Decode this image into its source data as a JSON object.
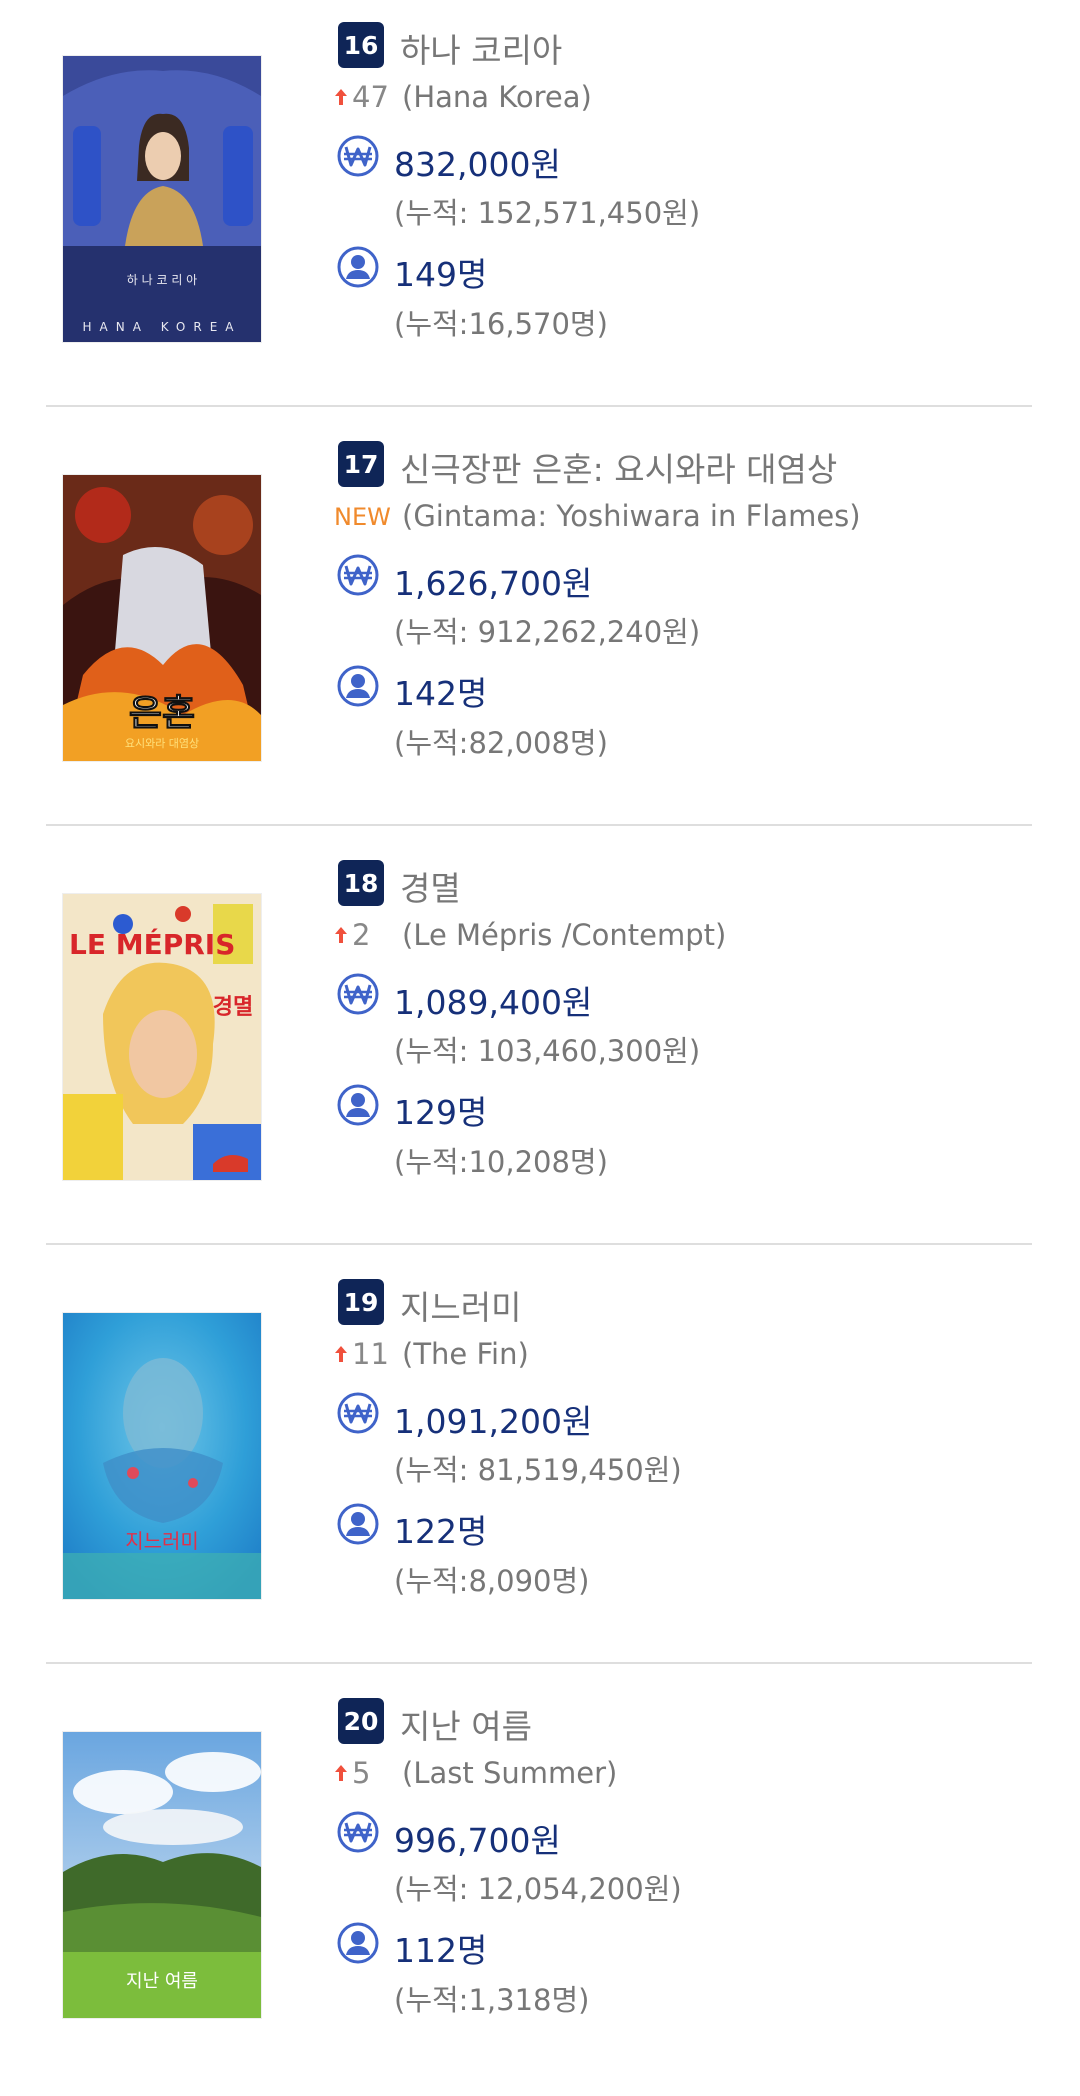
{
  "movies": [
    {
      "rank": "16",
      "title": "하나 코리아",
      "change": "47",
      "change_type": "up",
      "original_title": "(Hana Korea)",
      "sales": "832,000원",
      "sales_total": "(누적: 152,571,450원)",
      "audience": "149명",
      "audience_total": "(누적:16,570명)",
      "poster_text_top": "하 나 코 리 아",
      "poster_text_bottom": "HANA KOREA"
    },
    {
      "rank": "17",
      "title": "신극장판 은혼: 요시와라 대염상",
      "change": "NEW",
      "change_type": "new",
      "original_title": "(Gintama: Yoshiwara in Flames)",
      "sales": "1,626,700원",
      "sales_total": "(누적: 912,262,240원)",
      "audience": "142명",
      "audience_total": "(누적:82,008명)",
      "poster_text_top": "은혼",
      "poster_text_bottom": "요시와라 대염상"
    },
    {
      "rank": "18",
      "title": "경멸",
      "change": "2",
      "change_type": "up",
      "original_title": "(Le Mépris /Contempt)",
      "sales": "1,089,400원",
      "sales_total": "(누적: 103,460,300원)",
      "audience": "129명",
      "audience_total": "(누적:10,208명)",
      "poster_text_top": "LE MÉPRIS",
      "poster_text_bottom": "경멸"
    },
    {
      "rank": "19",
      "title": "지느러미",
      "change": "11",
      "change_type": "up",
      "original_title": "(The Fin)",
      "sales": "1,091,200원",
      "sales_total": "(누적: 81,519,450원)",
      "audience": "122명",
      "audience_total": "(누적:8,090명)",
      "poster_text_top": "",
      "poster_text_bottom": "지느러미"
    },
    {
      "rank": "20",
      "title": "지난 여름",
      "change": "5",
      "change_type": "up",
      "original_title": "(Last Summer)",
      "sales": "996,700원",
      "sales_total": "(누적: 12,054,200원)",
      "audience": "112명",
      "audience_total": "(누적:1,318명)",
      "poster_text_top": "",
      "poster_text_bottom": "지난 여름"
    }
  ],
  "colors": {
    "badge": "#0f2557",
    "value_text": "#163079",
    "icon": "#3f63c9",
    "arrow_up": "#f0503c",
    "new_label": "#f08a2c"
  }
}
